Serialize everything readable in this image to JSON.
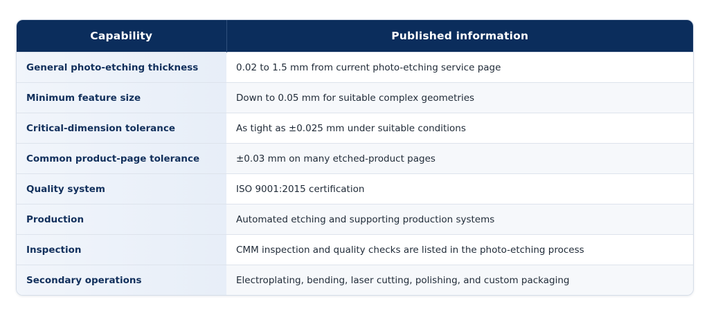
{
  "table": {
    "headers": {
      "capability": "Capability",
      "info": "Published information"
    },
    "rows": [
      {
        "capability": "General photo-etching thickness",
        "info": "0.02 to 1.5 mm from current photo-etching service page"
      },
      {
        "capability": "Minimum feature size",
        "info": "Down to 0.05 mm for suitable complex geometries"
      },
      {
        "capability": "Critical-dimension tolerance",
        "info": "As tight as ±0.025 mm under suitable conditions"
      },
      {
        "capability": "Common product-page tolerance",
        "info": "±0.03 mm on many etched-product pages"
      },
      {
        "capability": "Quality system",
        "info": "ISO 9001:2015 certification"
      },
      {
        "capability": "Production",
        "info": "Automated etching and supporting production systems"
      },
      {
        "capability": "Inspection",
        "info": "CMM inspection and quality checks are listed in the photo-etching process"
      },
      {
        "capability": "Secondary operations",
        "info": "Electroplating, bending, laser cutting, polishing, and custom packaging"
      }
    ]
  },
  "colors": {
    "header_bg": "#0b2d5c",
    "header_text": "#ffffff",
    "capability_text": "#12305c",
    "body_text": "#1f2a37"
  }
}
